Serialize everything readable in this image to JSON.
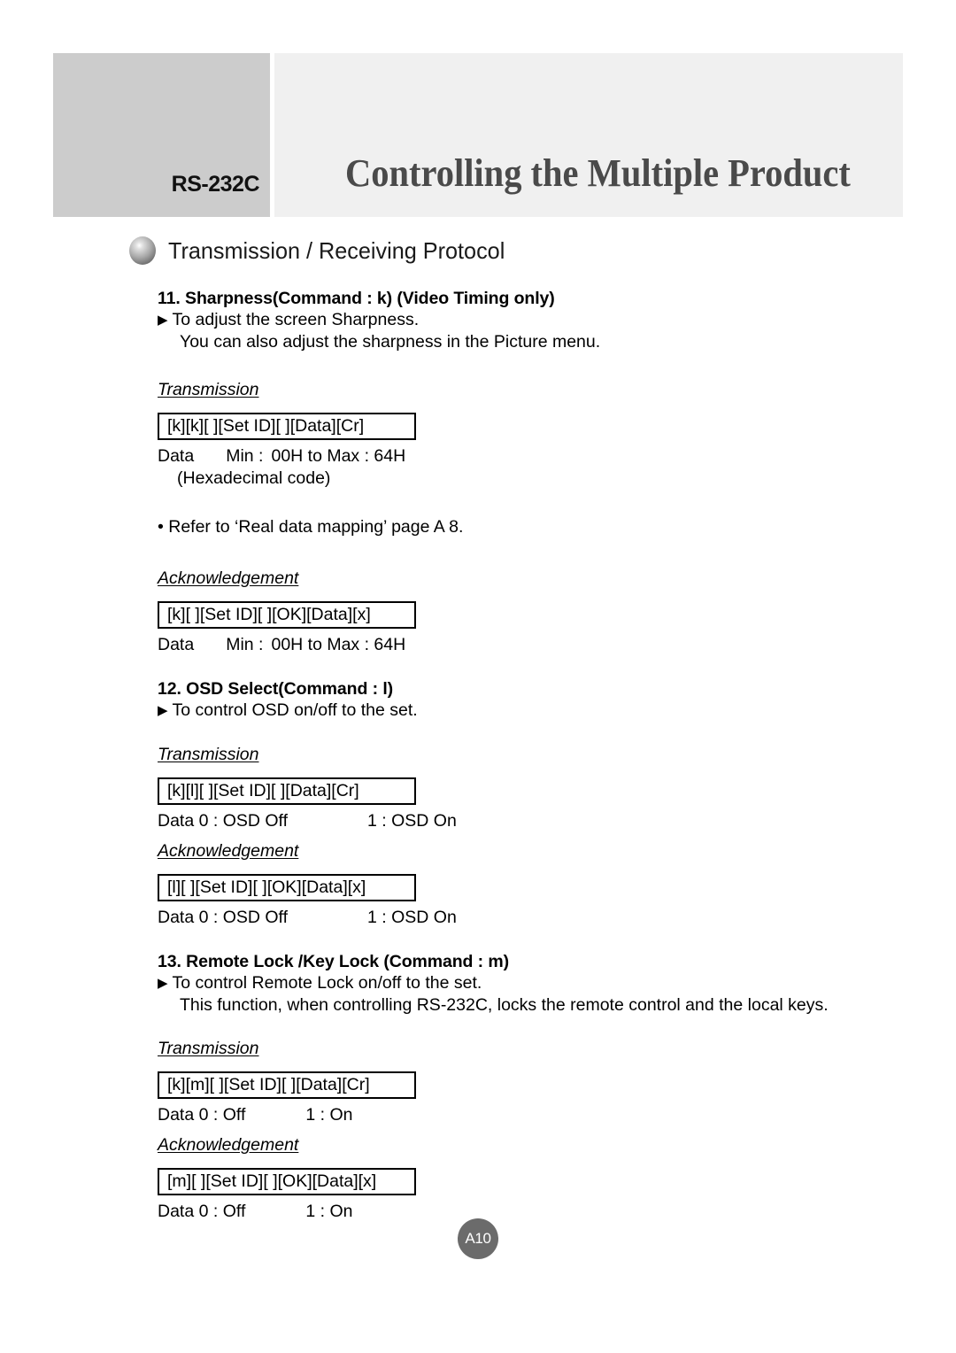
{
  "header": {
    "tab_label": "RS-232C",
    "title": "Controlling the Multiple Product",
    "tab_bg": "#cccccc",
    "band_bg": "#f0f0f0",
    "title_color": "#4a4a4a"
  },
  "section": {
    "bullet_icon": "sphere-bullet-icon",
    "heading": "Transmission / Receiving Protocol"
  },
  "commands": [
    {
      "title": "11. Sharpness(Command : k) (Video Timing only)",
      "bullet_glyph": "▶",
      "bullet_text": "To adjust the screen Sharpness.",
      "continuation": "You can also adjust the sharpness in the Picture menu.",
      "transmission_label": "Transmission",
      "transmission_box": "[k][k][ ][Set ID][ ][Data][Cr]",
      "transmission_data_label": "Data",
      "transmission_data_min": "Min :",
      "transmission_data_range": "00H to Max : 64H",
      "transmission_data_note": "(Hexadecimal code)",
      "reference_note": "• Refer to ‘Real data mapping’ page A 8.",
      "ack_label": "Acknowledgement",
      "ack_box": "[k][ ][Set ID][ ][OK][Data][x]",
      "ack_data_label": "Data",
      "ack_data_min": "Min :",
      "ack_data_range": "00H to Max : 64H"
    },
    {
      "title": "12. OSD Select(Command : l)",
      "bullet_glyph": "▶",
      "bullet_text": "To control OSD on/off to the set.",
      "transmission_label": "Transmission",
      "transmission_box": "[k][l][ ][Set ID][ ][Data][Cr]",
      "transmission_data_label": "Data 0 : OSD Off",
      "transmission_data_value": "1 : OSD On",
      "ack_label": "Acknowledgement",
      "ack_box": "[l][ ][Set ID][ ][OK][Data][x]",
      "ack_data_label": "Data 0 : OSD Off",
      "ack_data_value": "1 : OSD On"
    },
    {
      "title": "13. Remote Lock /Key Lock (Command : m)",
      "bullet_glyph": "▶",
      "bullet_text": "To control Remote Lock on/off to the set.",
      "continuation": "This function, when controlling RS-232C, locks the remote control and the local keys.",
      "transmission_label": "Transmission",
      "transmission_box": "[k][m][ ][Set ID][ ][Data][Cr]",
      "transmission_data_label": "Data 0 : Off",
      "transmission_data_value": "1 : On",
      "ack_label": "Acknowledgement",
      "ack_box": "[m][ ][Set ID][ ][OK][Data][x]",
      "ack_data_label": "Data 0 : Off",
      "ack_data_value": "1 : On"
    }
  ],
  "footer": {
    "page_number": "A10",
    "circle_color": "#6b6b6b"
  }
}
